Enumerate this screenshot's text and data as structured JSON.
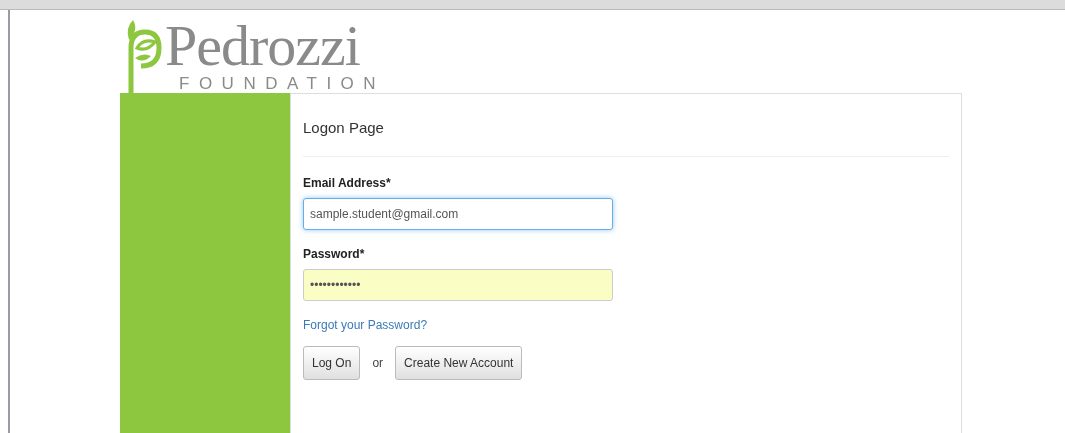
{
  "logo": {
    "name": "Pedrozzi",
    "tagline": "FOUNDATION"
  },
  "panel": {
    "title": "Logon Page"
  },
  "fields": [
    {
      "label": "Email Address",
      "required_mark": "*",
      "value": "sample.student@gmail.com",
      "focused": true,
      "autofilled": false
    },
    {
      "label": "Password",
      "required_mark": "*",
      "value": "••••••••••••",
      "focused": false,
      "autofilled": true
    }
  ],
  "forgot_link": "Forgot your Password?",
  "buttons": [
    {
      "label": "Log On"
    },
    {
      "label": "Create New Account"
    }
  ],
  "separator": "or"
}
